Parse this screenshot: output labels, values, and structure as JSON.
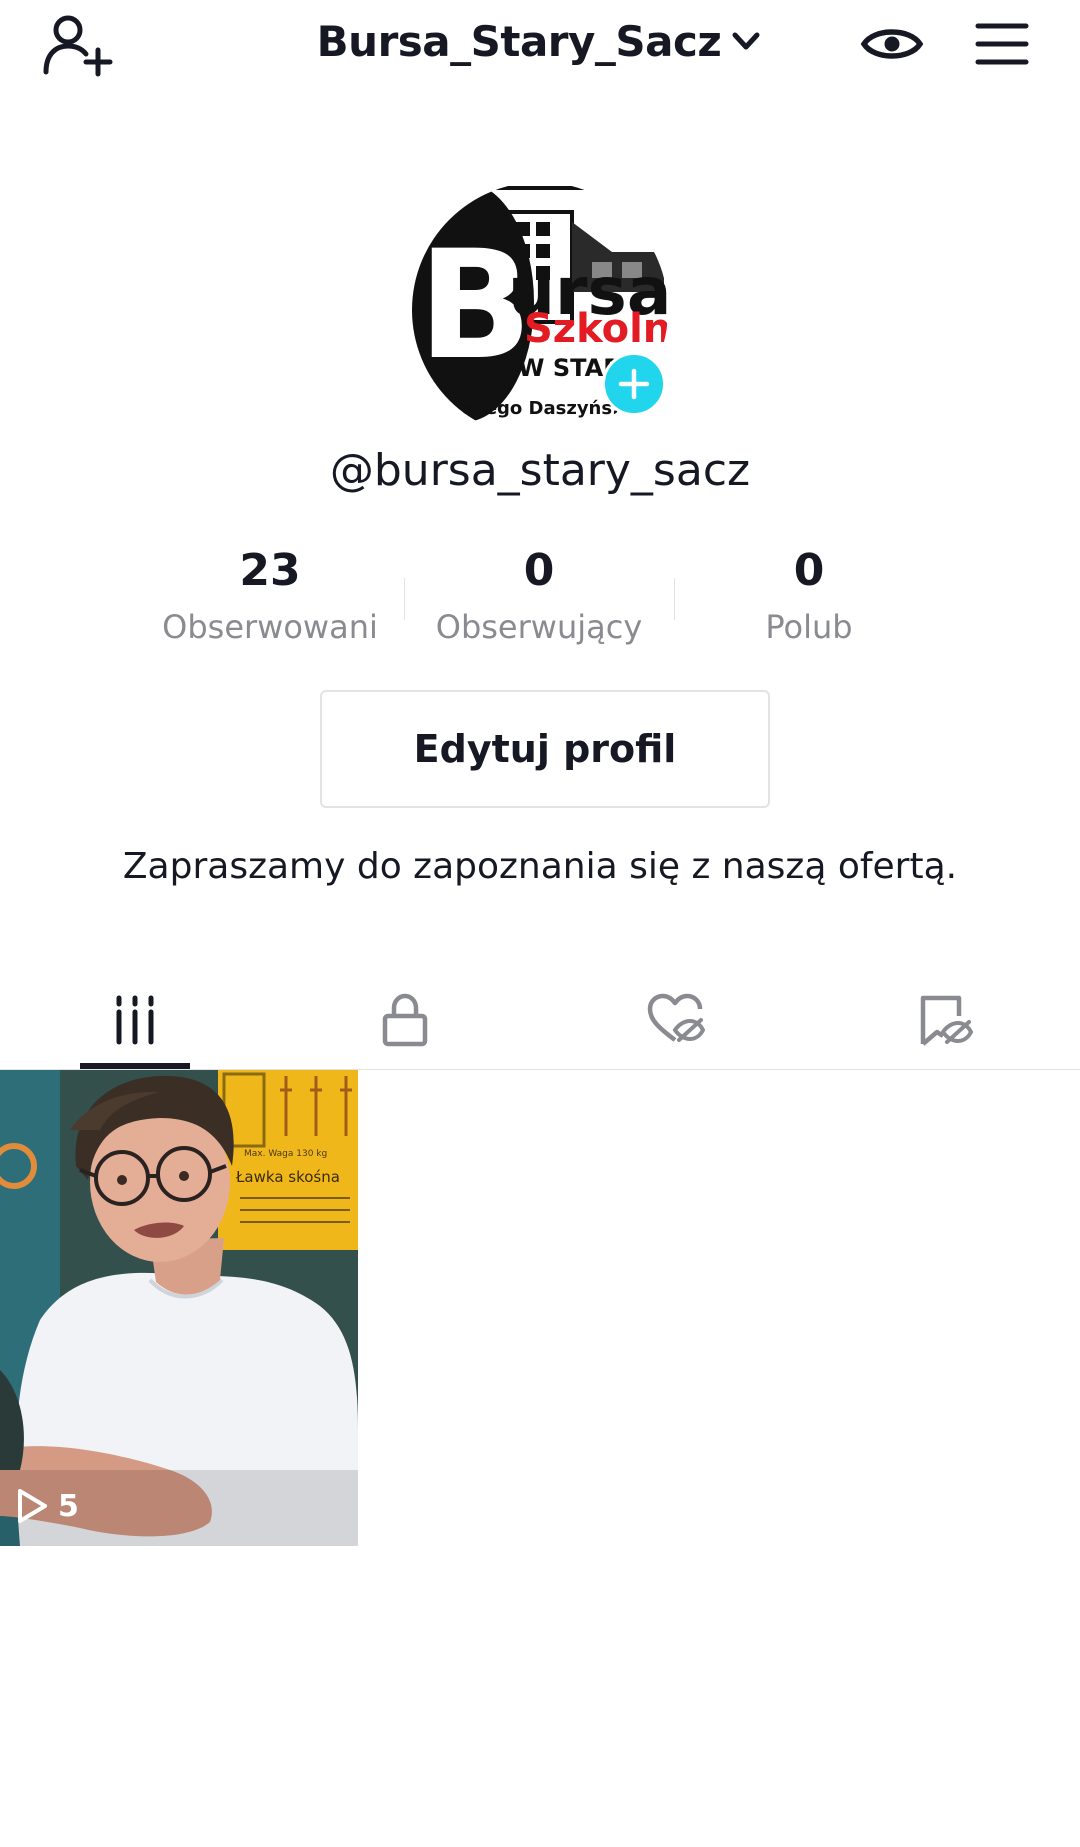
{
  "header": {
    "username": "Bursa_Stary_Sacz",
    "icons": {
      "add_user": "add-user-icon",
      "switch_account": "chevron-down-icon",
      "profile_views": "eye-icon",
      "menu": "hamburger-menu-icon"
    }
  },
  "profile": {
    "handle": "@bursa_stary_sacz",
    "avatar_text": {
      "big_letter": "B",
      "line1": "ursa",
      "line2": "Szkoln",
      "line3": "W STARY",
      "line4": "acego Daszyńs."
    },
    "stats": [
      {
        "value": "23",
        "label": "Obserwowani"
      },
      {
        "value": "0",
        "label": "Obserwujący"
      },
      {
        "value": "0",
        "label": "Polub"
      }
    ],
    "edit_button": "Edytuj profil",
    "bio": "Zapraszamy do zapoznania się z naszą ofertą."
  },
  "tabs": [
    {
      "icon": "videos-grid-icon",
      "active": true
    },
    {
      "icon": "lock-icon",
      "active": false
    },
    {
      "icon": "liked-hidden-icon",
      "active": false
    },
    {
      "icon": "saved-hidden-icon",
      "active": false
    }
  ],
  "videos": [
    {
      "play_count": "5",
      "poster_text_1": "Max. Waga 130 kg",
      "poster_text_2": "Ławka skośna"
    }
  ],
  "colors": {
    "text_primary": "#161823",
    "text_secondary": "#8a8b91",
    "border": "#e3e3e4",
    "accent_plus": "#20d5ec",
    "avatar_red": "#e31b23"
  }
}
